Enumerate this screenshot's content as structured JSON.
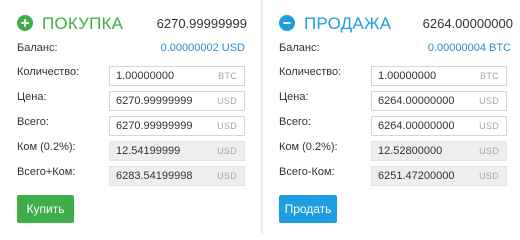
{
  "colors": {
    "buy_accent": "#3fae49",
    "sell_accent": "#1e9ee0"
  },
  "buy": {
    "title": "ПОКУПКА",
    "header_value": "6270.99999999",
    "balance_label": "Баланс:",
    "balance_value": "0.00000002 USD",
    "rows": [
      {
        "label": "Количество:",
        "value": "1.00000000",
        "unit": "BTC"
      },
      {
        "label": "Цена:",
        "value": "6270.99999999",
        "unit": "USD"
      },
      {
        "label": "Всего:",
        "value": "6270.99999999",
        "unit": "USD"
      },
      {
        "label": "Ком (0.2%):",
        "value": "12.54199999",
        "unit": "USD"
      },
      {
        "label": "Всего+Ком:",
        "value": "6283.54199998",
        "unit": "USD"
      }
    ],
    "button_label": "Купить"
  },
  "sell": {
    "title": "ПРОДАЖА",
    "header_value": "6264.00000000",
    "balance_label": "Баланс:",
    "balance_value": "0.00000004 BTC",
    "rows": [
      {
        "label": "Количество:",
        "value": "1.00000000",
        "unit": "BTC"
      },
      {
        "label": "Цена:",
        "value": "6264.00000000",
        "unit": "USD"
      },
      {
        "label": "Всего:",
        "value": "6264.00000000",
        "unit": "USD"
      },
      {
        "label": "Ком (0.2%):",
        "value": "12.52800000",
        "unit": "USD"
      },
      {
        "label": "Всего-Ком:",
        "value": "6251.47200000",
        "unit": "USD"
      }
    ],
    "button_label": "Продать"
  }
}
